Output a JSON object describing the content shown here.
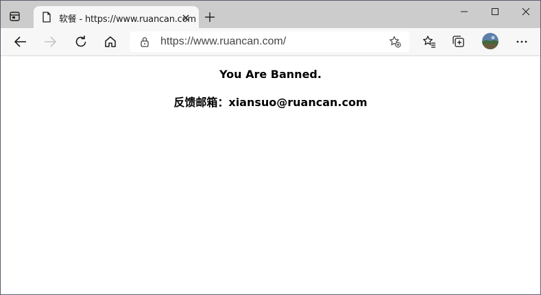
{
  "tab": {
    "title": "软餐 - https://www.ruancan.com"
  },
  "address_bar": {
    "url": "https://www.ruancan.com/"
  },
  "page": {
    "headline": "You Are Banned.",
    "contact_label": "反馈邮箱：",
    "contact_email": "xiansuo@ruancan.com"
  },
  "icons": {
    "tab_actions": "tab-actions-icon",
    "favicon": "page-icon",
    "tab_close": "close-icon",
    "new_tab": "plus-icon",
    "minimize": "minimize-icon",
    "maximize": "maximize-icon",
    "close": "close-icon",
    "back": "arrow-left-icon",
    "forward": "arrow-right-icon",
    "refresh": "refresh-icon",
    "home": "home-icon",
    "lock": "lock-icon",
    "add_favorite": "star-plus-icon",
    "favorites": "favorites-icon",
    "collections": "collections-icon",
    "more": "more-icon"
  },
  "colors": {
    "tab_strip": "#cccccc",
    "toolbar": "#f7f7f7",
    "content_bg": "#ffffff",
    "text": "#000000"
  }
}
